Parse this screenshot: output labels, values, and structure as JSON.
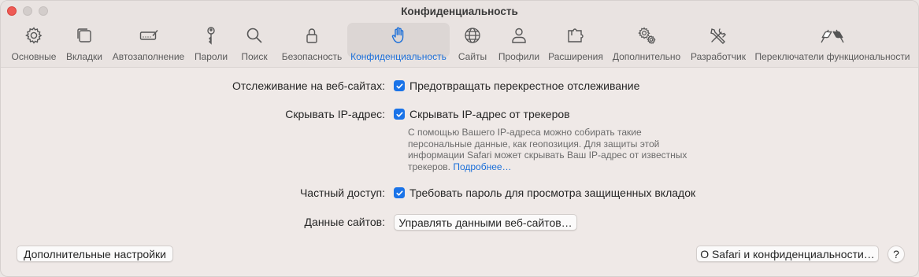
{
  "window": {
    "title": "Конфиденциальность"
  },
  "toolbar": {
    "tabs": [
      {
        "label": "Основные",
        "icon": "gear-icon"
      },
      {
        "label": "Вкладки",
        "icon": "tabs-icon"
      },
      {
        "label": "Автозаполнение",
        "icon": "autofill-icon"
      },
      {
        "label": "Пароли",
        "icon": "key-icon"
      },
      {
        "label": "Поиск",
        "icon": "search-icon"
      },
      {
        "label": "Безопасность",
        "icon": "lock-icon"
      },
      {
        "label": "Конфиденциальность",
        "icon": "hand-icon",
        "active": true
      },
      {
        "label": "Сайты",
        "icon": "globe-icon"
      },
      {
        "label": "Профили",
        "icon": "person-icon"
      },
      {
        "label": "Расширения",
        "icon": "puzzle-icon"
      },
      {
        "label": "Дополнительно",
        "icon": "gears-icon"
      },
      {
        "label": "Разработчик",
        "icon": "tools-icon"
      },
      {
        "label": "Переключатели функциональности",
        "icon": "flags-icon"
      }
    ]
  },
  "privacy": {
    "tracking": {
      "label": "Отслеживание на веб-сайтах:",
      "checkbox_text": "Предотвращать перекрестное отслеживание",
      "checked": true
    },
    "hide_ip": {
      "label": "Скрывать IP-адрес:",
      "checkbox_text": "Скрывать IP-адрес от трекеров",
      "checked": true,
      "description": "С помощью Вашего IP-адреса можно собирать такие персональные данные, как геопозиция. Для защиты этой информации Safari может скрывать Ваш IP-адрес от известных трекеров.",
      "link_text": "Подробнее…"
    },
    "private_access": {
      "label": "Частный доступ:",
      "checkbox_text": "Требовать пароль для просмотра защищенных вкладок",
      "checked": true
    },
    "site_data": {
      "label": "Данные сайтов:",
      "button_label": "Управлять данными веб-сайтов…"
    }
  },
  "footer": {
    "advanced_button": "Дополнительные настройки",
    "about_button": "О Safari и конфиденциальности…",
    "help_button": "?"
  },
  "colors": {
    "accent": "#1a73e8",
    "active_tab_text": "#1b6fd9",
    "close": "#ee5b55"
  }
}
